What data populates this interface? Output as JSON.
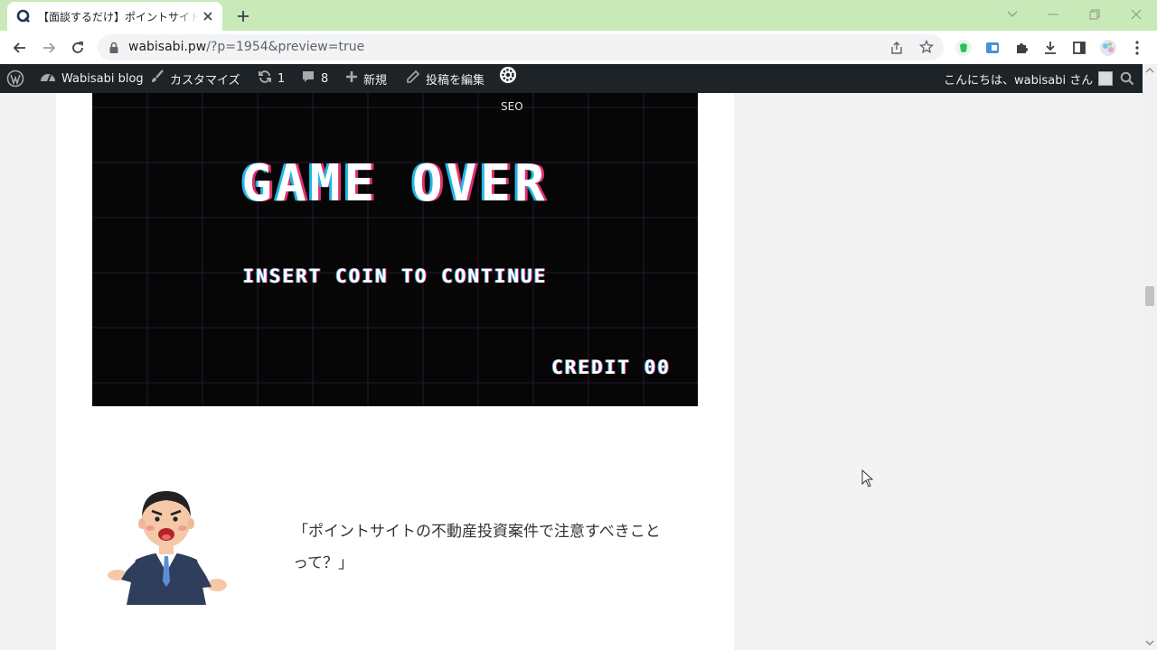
{
  "browser": {
    "tab_title": "【面談するだけ】ポイントサイトの不動産投資案件",
    "url_host": "wabisabi.pw",
    "url_path": "/?p=1954&preview=true"
  },
  "admin_bar": {
    "site_name": "Wabisabi blog",
    "customize": "カスタマイズ",
    "updates_count": "1",
    "comments_count": "8",
    "new_label": "新規",
    "edit_post": "投稿を編集",
    "greeting": "こんにちは、wabisabi さん"
  },
  "article": {
    "image": {
      "tag": "SEO",
      "title": "GAME OVER",
      "subtitle": "INSERT COIN TO CONTINUE",
      "credit": "CREDIT 00"
    },
    "speech_text": "「ポイントサイトの不動産投資案件で注意すべきことって？」"
  },
  "colors": {
    "tab_strip": "#c9e9b9",
    "admin_bar": "#1d2327",
    "page_bg": "#f3f3f3",
    "game_bg": "#060606"
  }
}
